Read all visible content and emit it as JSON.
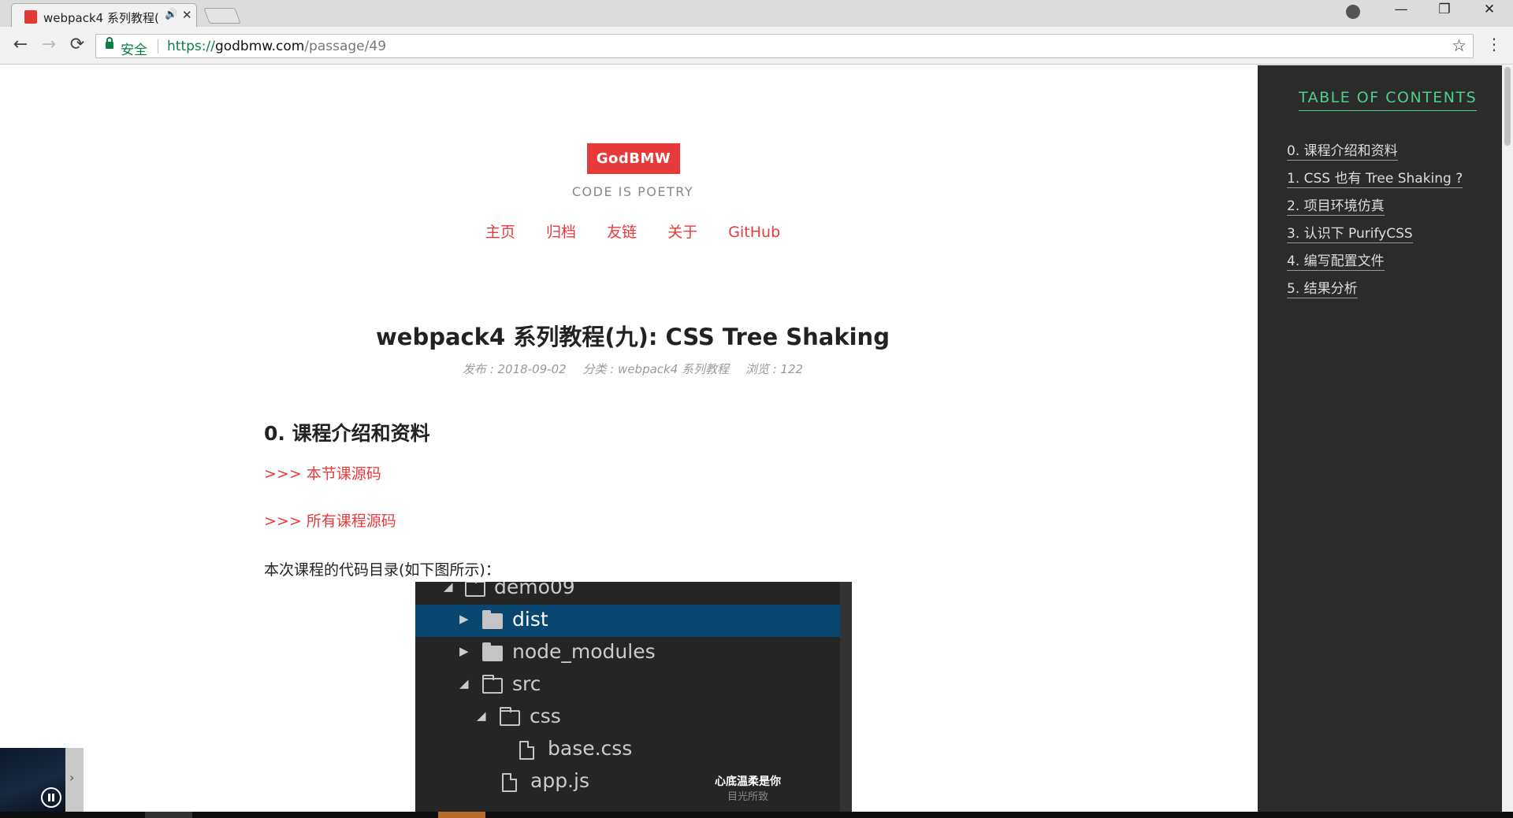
{
  "browser": {
    "tab": {
      "title": "webpack4 系列教程(",
      "audio_icon": "🔊",
      "close_icon": "✕"
    },
    "window_controls": {
      "minimize": "—",
      "maximize": "❐",
      "close": "✕"
    },
    "nav": {
      "back": "←",
      "forward": "→",
      "reload": "⟳"
    },
    "omnibox": {
      "secure_label": "安全",
      "url_scheme": "https://",
      "url_host": "godbmw.com",
      "url_path": "/passage/49",
      "star": "☆"
    },
    "menu": "⋮"
  },
  "site": {
    "brand": "GodBMW",
    "tagline": "CODE IS POETRY",
    "nav": [
      "主页",
      "归档",
      "友链",
      "关于",
      "GitHub"
    ]
  },
  "post": {
    "title": "webpack4 系列教程(九): CSS Tree Shaking",
    "meta": {
      "published": "发布 : 2018-09-02",
      "category": "分类 : webpack4 系列教程",
      "views": "浏览 : 122"
    },
    "section_heading": "0. 课程介绍和资料",
    "links": [
      ">>> 本节课源码",
      ">>> 所有课程源码"
    ],
    "paragraph": "本次课程的代码目录(如下图所示)：",
    "file_tree": [
      {
        "name": "demo09",
        "type": "folder-open",
        "level": 0,
        "expanded": true,
        "selected": false
      },
      {
        "name": "dist",
        "type": "folder",
        "level": 1,
        "expanded": false,
        "selected": true
      },
      {
        "name": "node_modules",
        "type": "folder",
        "level": 1,
        "expanded": false,
        "selected": false
      },
      {
        "name": "src",
        "type": "folder-open",
        "level": 1,
        "expanded": true,
        "selected": false
      },
      {
        "name": "css",
        "type": "folder-open",
        "level": 2,
        "expanded": true,
        "selected": false
      },
      {
        "name": "base.css",
        "type": "file",
        "level": 3,
        "selected": false
      },
      {
        "name": "app.js",
        "type": "file",
        "level": 2,
        "selected": false
      }
    ]
  },
  "music_overlay": {
    "title": "心底温柔是你",
    "subtitle": "目光所致"
  },
  "toc": {
    "title": "TABLE OF CONTENTS",
    "items": [
      "0. 课程介绍和资料",
      "1. CSS 也有 Tree Shaking ?",
      "2. 项目环境仿真",
      "3. 认识下 PurifyCSS",
      "4. 编写配置文件",
      "5. 结果分析"
    ]
  },
  "colors": {
    "accent": "#e8393b",
    "toc_bg": "#2b2b2b",
    "toc_title": "#4fd08a",
    "secure": "#0b8043",
    "tree_bg": "#252526",
    "tree_selected": "#094771"
  }
}
